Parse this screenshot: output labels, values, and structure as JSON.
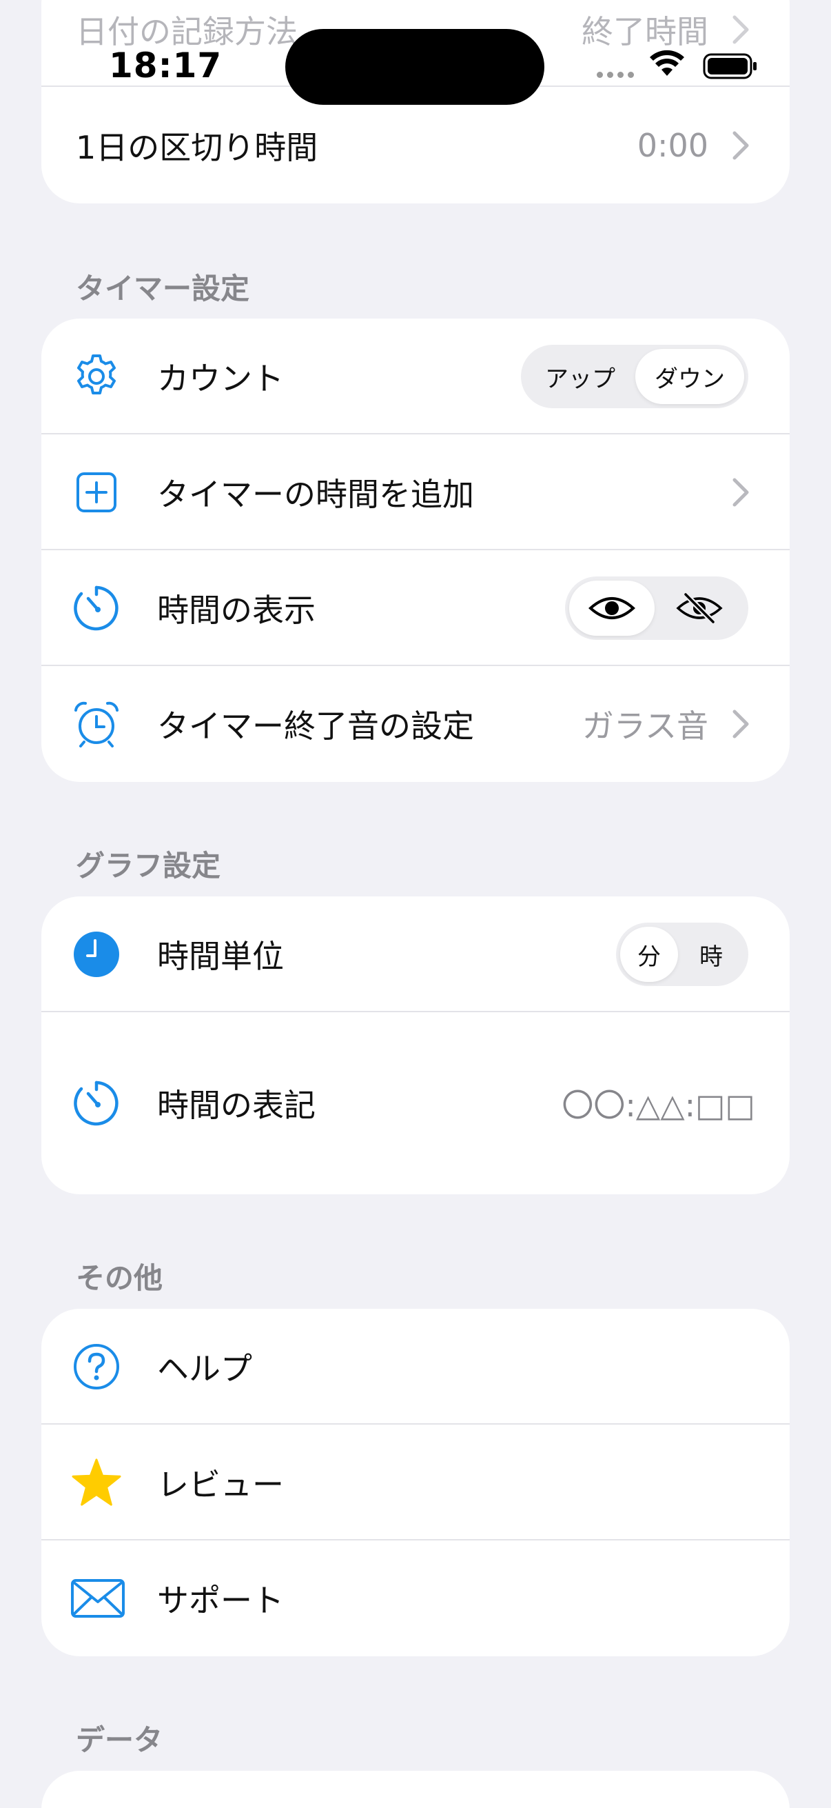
{
  "status": {
    "time": "18:17"
  },
  "top_card": {
    "row1_label": "日付の記録方法",
    "row1_value": "終了時間",
    "row2_label": "1日の区切り時間",
    "row2_value": "0:00"
  },
  "timer_section": {
    "title": "タイマー設定",
    "count_label": "カウント",
    "count_options": [
      "アップ",
      "ダウン"
    ],
    "add_time_label": "タイマーの時間を追加",
    "display_label": "時間の表示",
    "end_sound_label": "タイマー終了音の設定",
    "end_sound_value": "ガラス音"
  },
  "graph_section": {
    "title": "グラフ設定",
    "unit_label": "時間単位",
    "unit_options": [
      "分",
      "時"
    ],
    "notation_label": "時間の表記",
    "notation_value": "〇〇:△△:□□"
  },
  "other_section": {
    "title": "その他",
    "help_label": "ヘルプ",
    "review_label": "レビュー",
    "support_label": "サポート"
  },
  "data_section": {
    "title": "データ"
  },
  "colors": {
    "accent": "#1A8CE8",
    "star": "#FFCC00",
    "background": "#F1F1F6",
    "secondary_text": "#9B9BA0"
  }
}
